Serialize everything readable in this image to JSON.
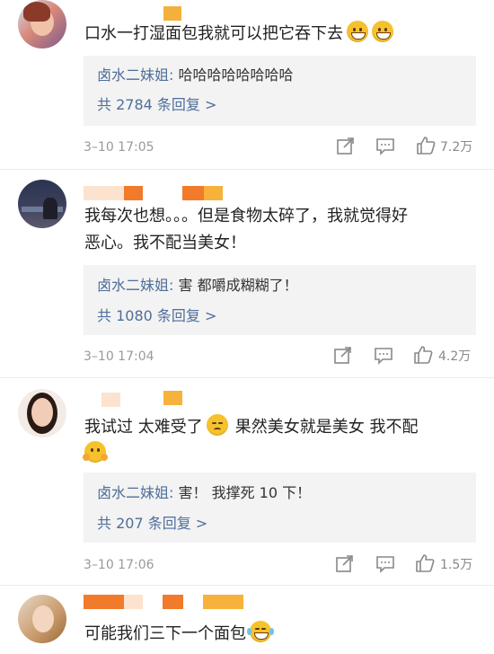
{
  "colors": {
    "link": "#4e6e9a",
    "meta": "#999999",
    "reply_bg": "#f3f3f3"
  },
  "comments": [
    {
      "text": "口水一打湿面包我就可以把它吞下去",
      "emoji": [
        "grin-emoji",
        "grin-emoji"
      ],
      "reply_author": "卤水二妹姐:",
      "reply_text": "哈哈哈哈哈哈哈哈",
      "reply_count": "共 2784 条回复 >",
      "time": "3–10 17:05",
      "likes": "7.2万"
    },
    {
      "text_line1": "我每次也想。。。但是食物太碎了，我就觉得好",
      "text_line2": "恶心。我不配当美女！",
      "reply_author": "卤水二妹姐:",
      "reply_text": "害 都嚼成糊糊了！",
      "reply_count": "共 1080 条回复 >",
      "time": "3–10 17:04",
      "likes": "4.2万"
    },
    {
      "text_line1": "我试过 太难受了",
      "text_line1b": "果然美女就是美女 我不配",
      "emoji": [
        "persevere-emoji",
        "hug-emoji"
      ],
      "reply_author": "卤水二妹姐:",
      "reply_text": "害！ 我撑死 10 下！",
      "reply_count": "共 207 条回复 >",
      "time": "3–10 17:06",
      "likes": "1.5万"
    },
    {
      "text": "可能我们三下一个面包",
      "emoji": [
        "laugh-cry-emoji"
      ]
    }
  ]
}
